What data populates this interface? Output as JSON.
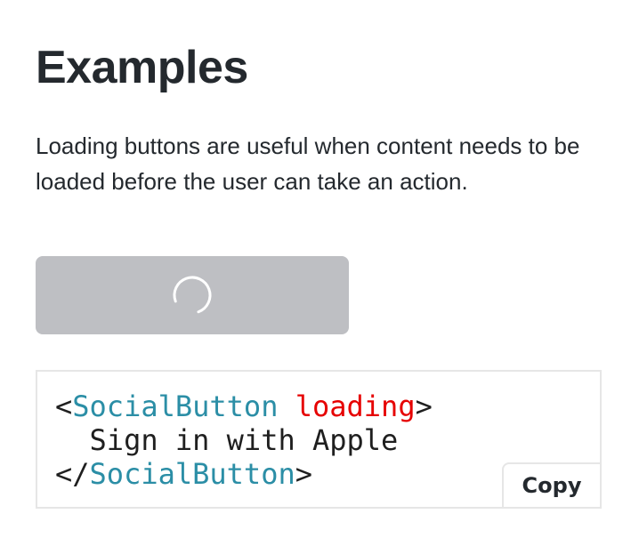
{
  "header": {
    "title": "Examples"
  },
  "intro": {
    "description": "Loading buttons are useful when content needs to be loaded before the user can take an action."
  },
  "example": {
    "button_state": "loading",
    "button_color": "#bebfc3",
    "spinner_icon": "spinner-icon"
  },
  "code": {
    "open_lt": "<",
    "component": "SocialButton",
    "space": " ",
    "attribute": "loading",
    "open_gt": ">",
    "child_text": "Sign in with Apple",
    "close_lt": "</",
    "close_component": "SocialButton",
    "close_gt": ">",
    "component_color": "#2b8ea6",
    "attribute_color": "#e60000",
    "copy_label": "Copy"
  }
}
